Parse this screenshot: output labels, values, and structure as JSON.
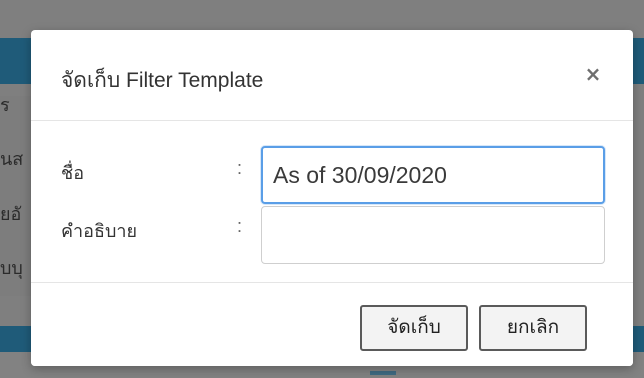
{
  "background": {
    "side_fragments": [
      "ร",
      "นส",
      "ยอั",
      "บบุ"
    ]
  },
  "dialog": {
    "title": "จัดเก็บ Filter Template",
    "close_label": "×"
  },
  "form": {
    "name_label": "ชื่อ",
    "name_colon": ":",
    "name_value": "As of 30/09/2020",
    "description_label": "คำอธิบาย",
    "description_colon": ":",
    "description_value": ""
  },
  "footer": {
    "save_label": "จัดเก็บ",
    "cancel_label": "ยกเลิก"
  }
}
